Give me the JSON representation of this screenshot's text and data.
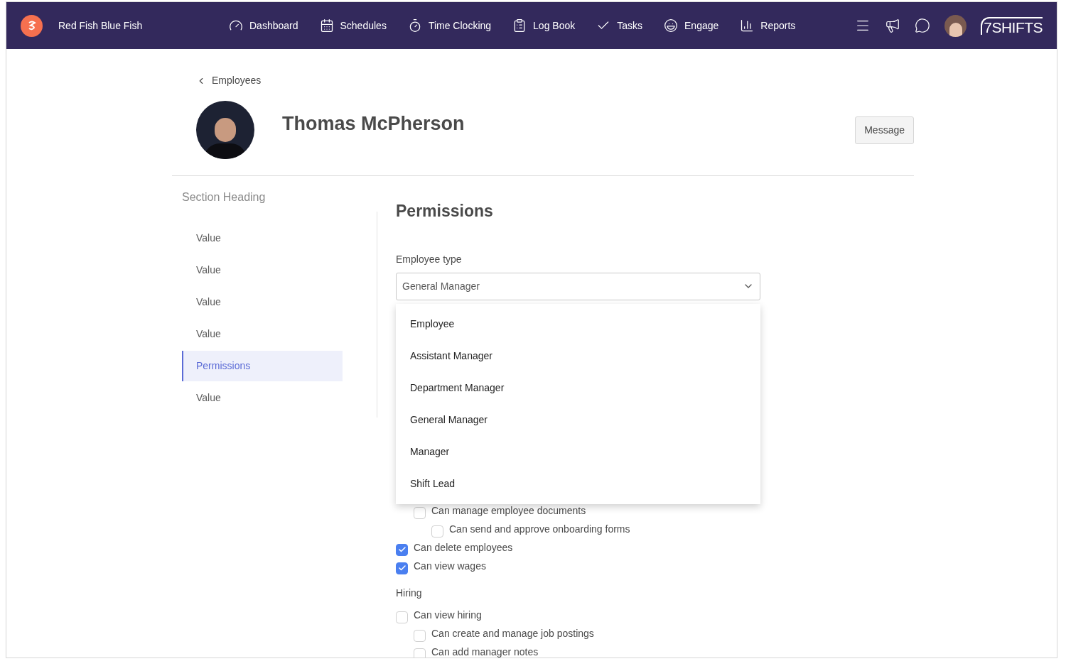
{
  "navbar": {
    "brand": "Red Fish Blue Fish",
    "items": [
      {
        "label": "Dashboard"
      },
      {
        "label": "Schedules"
      },
      {
        "label": "Time Clocking"
      },
      {
        "label": "Log Book"
      },
      {
        "label": "Tasks"
      },
      {
        "label": "Engage"
      },
      {
        "label": "Reports"
      }
    ],
    "logo": "7SHIFTS"
  },
  "back_link": "Employees",
  "profile": {
    "name": "Thomas McPherson",
    "message_button": "Message"
  },
  "sidebar": {
    "heading": "Section Heading",
    "items": [
      {
        "label": "Value",
        "selected": false
      },
      {
        "label": "Value",
        "selected": false
      },
      {
        "label": "Value",
        "selected": false
      },
      {
        "label": "Value",
        "selected": false
      },
      {
        "label": "Permissions",
        "selected": true
      },
      {
        "label": "Value",
        "selected": false
      }
    ]
  },
  "permissions": {
    "title": "Permissions",
    "employee_type": {
      "label": "Employee type",
      "value": "General Manager",
      "expanded": true,
      "options": [
        "Employee",
        "Assistant Manager",
        "Department Manager",
        "General Manager",
        "Manager",
        "Shift Lead"
      ]
    },
    "items": [
      {
        "children": [
          {
            "label": "Can manage employee documents",
            "checked": false,
            "children": [
              {
                "label": "Can send and approve onboarding forms",
                "checked": false
              }
            ]
          }
        ]
      },
      {
        "label": "Can delete employees",
        "checked": true
      },
      {
        "label": "Can view wages",
        "checked": true
      }
    ],
    "sections": [
      {
        "heading": "Hiring",
        "items": [
          {
            "label": "Can view hiring",
            "checked": false,
            "children": [
              {
                "label": "Can create and manage job postings",
                "checked": false
              },
              {
                "label": "Can add manager notes",
                "checked": false
              }
            ]
          }
        ]
      }
    ]
  }
}
